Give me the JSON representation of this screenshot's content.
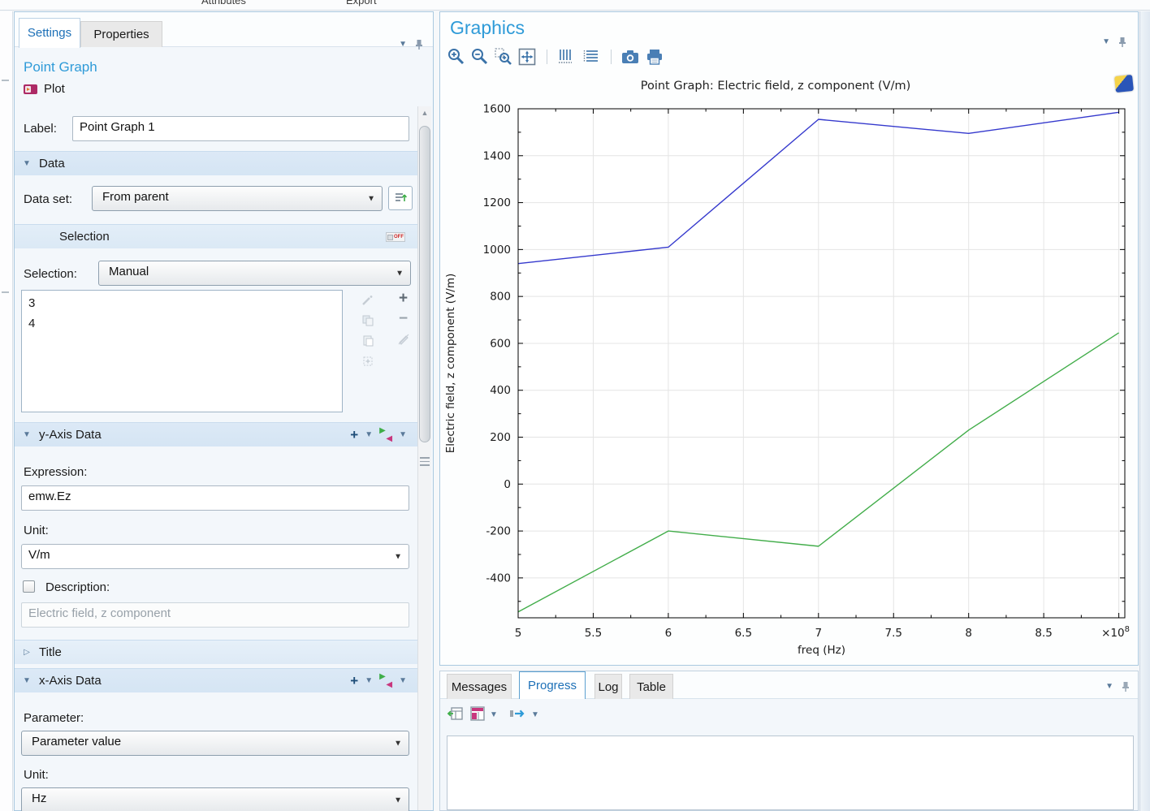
{
  "colors": {
    "accent": "#1d70b7",
    "heading": "#2f9bd8",
    "section_header_bg": "#dce9f6",
    "series_blue": "#3539cd",
    "series_green": "#42ad4a"
  },
  "ribbon": {
    "attributes": "Attributes",
    "export": "Export"
  },
  "settings_panel": {
    "tabs": [
      {
        "label": "Settings",
        "active": true
      },
      {
        "label": "Properties",
        "active": false
      }
    ],
    "heading": "Point Graph",
    "plot_button": "Plot",
    "label_field": {
      "label": "Label:",
      "value": "Point Graph 1"
    },
    "data_section": {
      "title": "Data",
      "dataset_label": "Data set:",
      "dataset_value": "From parent",
      "selection_header": "Selection",
      "selection_toggle": "OFF",
      "selection_label": "Selection:",
      "selection_value": "Manual",
      "selection_items": [
        "3",
        "4"
      ]
    },
    "y_axis_section": {
      "title": "y-Axis Data",
      "expression_label": "Expression:",
      "expression_value": "emw.Ez",
      "unit_label": "Unit:",
      "unit_value": "V/m",
      "description_label": "Description:",
      "description_value": "Electric field, z component"
    },
    "title_section": {
      "title": "Title"
    },
    "x_axis_section": {
      "title": "x-Axis Data",
      "parameter_label": "Parameter:",
      "parameter_value": "Parameter value",
      "unit_label": "Unit:",
      "unit_value": "Hz"
    }
  },
  "graphics_panel": {
    "title": "Graphics",
    "plot_title": "Point Graph: Electric field, z component (V/m)"
  },
  "bottom_panel": {
    "tabs": [
      {
        "label": "Messages",
        "active": false
      },
      {
        "label": "Progress",
        "active": true
      },
      {
        "label": "Log",
        "active": false
      },
      {
        "label": "Table",
        "active": false
      }
    ]
  },
  "chart_data": {
    "type": "line",
    "title": "Point Graph: Electric field, z component (V/m)",
    "xlabel": "freq (Hz)",
    "ylabel": "Electric field, z component (V/m)",
    "x_scale_label": "×10⁸",
    "x_scale_exponent": 8,
    "xlim": [
      5,
      9.04
    ],
    "ylim": [
      -570,
      1600
    ],
    "x_ticks": [
      5,
      5.5,
      6,
      6.5,
      7,
      7.5,
      8,
      8.5
    ],
    "x_tick_step": 0.5,
    "x_minor_step": 0.25,
    "y_ticks": [
      -400,
      -200,
      0,
      200,
      400,
      600,
      800,
      1000,
      1200,
      1400,
      1600
    ],
    "y_tick_step": 200,
    "y_minor_step": 100,
    "grid": true,
    "legend": "none",
    "series": [
      {
        "name": "series 1 (blue)",
        "color": "#3539cd",
        "x": [
          5,
          6,
          7,
          8,
          9
        ],
        "values": [
          940,
          1010,
          1555,
          1495,
          1585
        ]
      },
      {
        "name": "series 2 (green)",
        "color": "#42ad4a",
        "x": [
          5,
          6,
          7,
          8,
          9
        ],
        "values": [
          -545,
          -200,
          -265,
          230,
          645
        ]
      }
    ]
  }
}
